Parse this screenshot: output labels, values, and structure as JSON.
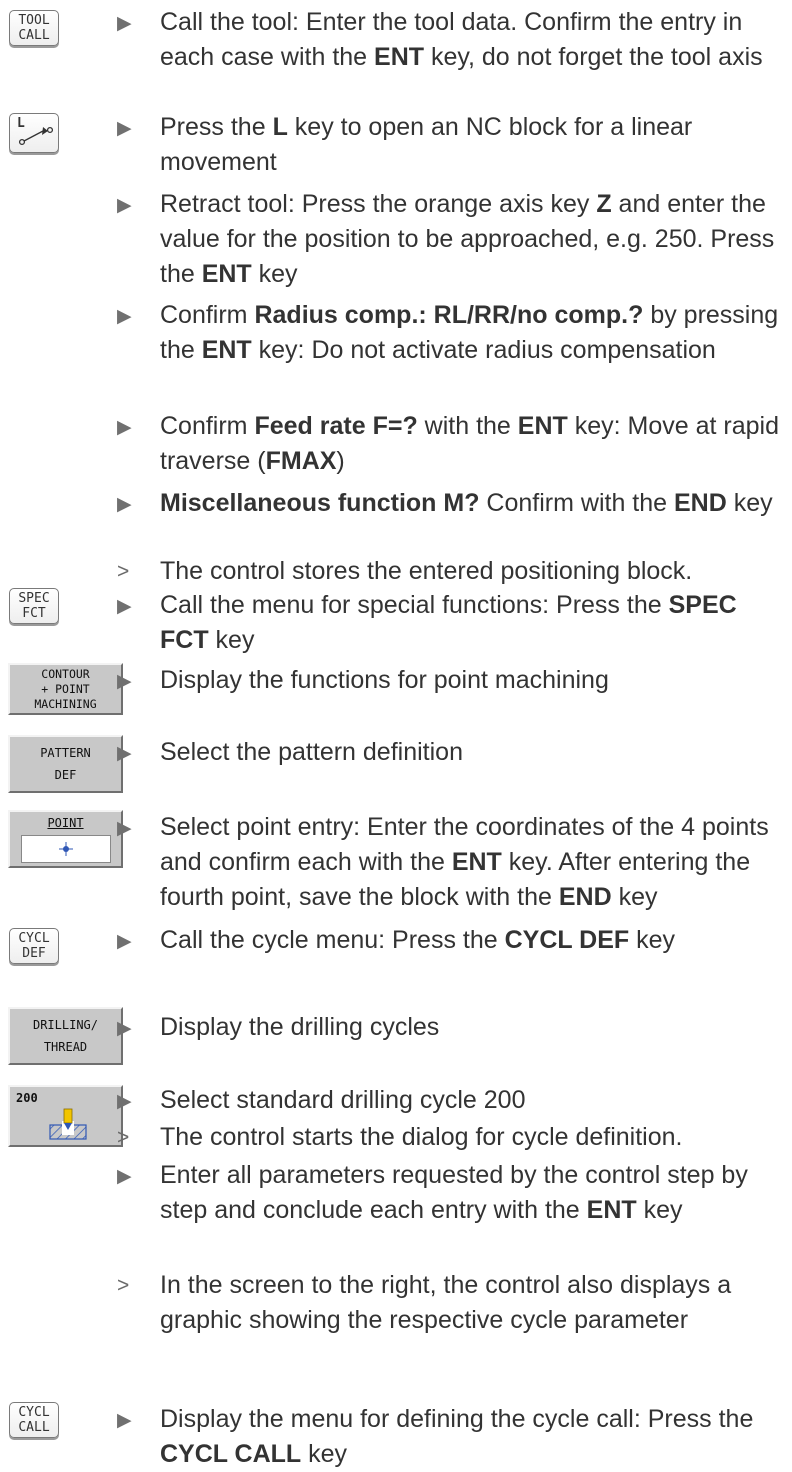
{
  "keys": {
    "tool_call": [
      "TOOL",
      "CALL"
    ],
    "l_key": "L",
    "spec_fct": [
      "SPEC",
      "FCT"
    ],
    "contour_point": [
      "CONTOUR",
      "+ POINT",
      "MACHINING"
    ],
    "pattern_def": [
      "PATTERN",
      "DEF"
    ],
    "point": "POINT",
    "cycl_def": [
      "CYCL",
      "DEF"
    ],
    "drilling_thread": [
      "DRILLING/",
      "THREAD"
    ],
    "cycle_200": "200",
    "cycl_call": [
      "CYCL",
      "CALL"
    ]
  },
  "steps": [
    {
      "marker": "▶",
      "runs": [
        [
          "Call the tool: Enter the tool data. Confirm the entry in each case with the ",
          false
        ],
        [
          "ENT",
          true
        ],
        [
          " key, do not forget the tool axis",
          false
        ]
      ]
    },
    {
      "marker": "▶",
      "runs": [
        [
          "Press the ",
          false
        ],
        [
          "L",
          true
        ],
        [
          " key to open an NC block for a linear movement",
          false
        ]
      ]
    },
    {
      "marker": "▶",
      "runs": [
        [
          "Retract tool: Press the orange axis key ",
          false
        ],
        [
          "Z",
          true
        ],
        [
          " and enter the value for the position to be approached, e.g. 250. Press the ",
          false
        ],
        [
          "ENT",
          true
        ],
        [
          " key",
          false
        ]
      ]
    },
    {
      "marker": "▶",
      "runs": [
        [
          "Confirm ",
          false
        ],
        [
          "Radius comp.: RL/RR/no comp.?",
          true
        ],
        [
          " by pressing the ",
          false
        ],
        [
          "ENT",
          true
        ],
        [
          " key: Do not activate radius compensation",
          false
        ]
      ]
    },
    {
      "marker": "▶",
      "runs": [
        [
          "Confirm ",
          false
        ],
        [
          "Feed rate F=?",
          true
        ],
        [
          " with the ",
          false
        ],
        [
          "ENT",
          true
        ],
        [
          " key: Move at rapid traverse (",
          false
        ],
        [
          "FMAX",
          true
        ],
        [
          ")",
          false
        ]
      ]
    },
    {
      "marker": "▶",
      "runs": [
        [
          "Miscellaneous function M?",
          true
        ],
        [
          " Confirm with the ",
          false
        ],
        [
          "END",
          true
        ],
        [
          " key",
          false
        ]
      ]
    },
    {
      "marker": ">",
      "runs": [
        [
          "The control stores the entered positioning block.",
          false
        ]
      ]
    },
    {
      "marker": "▶",
      "runs": [
        [
          "Call the menu for special functions: Press the ",
          false
        ],
        [
          "SPEC FCT",
          true
        ],
        [
          " key",
          false
        ]
      ]
    },
    {
      "marker": "▶",
      "runs": [
        [
          "Display the functions for point machining",
          false
        ]
      ]
    },
    {
      "marker": "▶",
      "runs": [
        [
          "Select the pattern definition",
          false
        ]
      ]
    },
    {
      "marker": "▶",
      "runs": [
        [
          "Select point entry: Enter the coordinates of the 4 points and confirm each with the ",
          false
        ],
        [
          "ENT",
          true
        ],
        [
          " key. After entering the fourth point, save the block with the ",
          false
        ],
        [
          "END",
          true
        ],
        [
          " key",
          false
        ]
      ]
    },
    {
      "marker": "▶",
      "runs": [
        [
          "Call the cycle menu: Press the ",
          false
        ],
        [
          "CYCL DEF",
          true
        ],
        [
          " key",
          false
        ]
      ]
    },
    {
      "marker": "▶",
      "runs": [
        [
          "Display the drilling cycles",
          false
        ]
      ]
    },
    {
      "marker": "▶",
      "runs": [
        [
          "Select standard drilling cycle 200",
          false
        ]
      ]
    },
    {
      "marker": ">",
      "runs": [
        [
          "The control starts the dialog for cycle definition.",
          false
        ]
      ]
    },
    {
      "marker": "▶",
      "runs": [
        [
          "Enter all parameters requested by the control step by step and conclude each entry with the ",
          false
        ],
        [
          "ENT",
          true
        ],
        [
          " key",
          false
        ]
      ]
    },
    {
      "marker": ">",
      "runs": [
        [
          "In the screen to the right, the control also displays a graphic showing the respective cycle parameter",
          false
        ]
      ]
    },
    {
      "marker": "▶",
      "runs": [
        [
          "Display the menu for defining the cycle call: Press the ",
          false
        ],
        [
          "CYCL CALL",
          true
        ],
        [
          " key",
          false
        ]
      ]
    }
  ]
}
